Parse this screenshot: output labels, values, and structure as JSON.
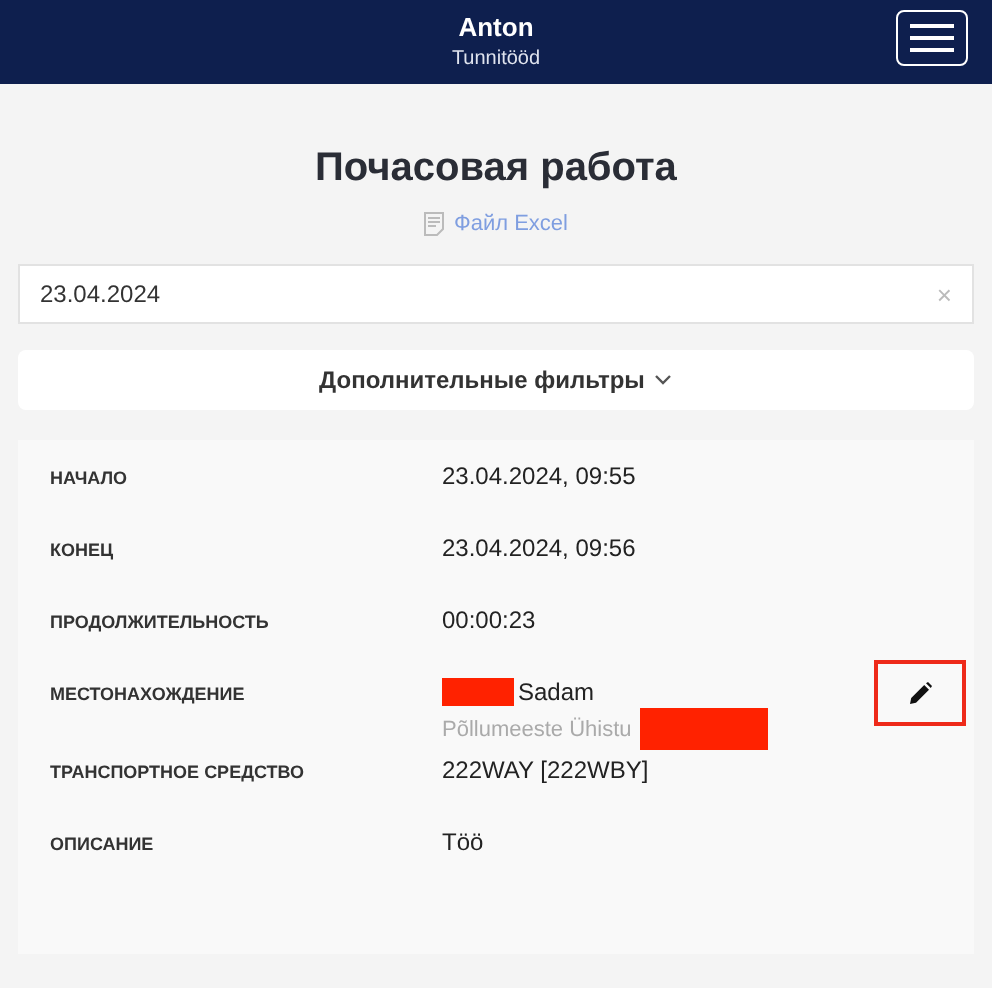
{
  "header": {
    "user": "Anton",
    "subtitle": "Tunnitööd"
  },
  "page": {
    "title": "Почасовая работа",
    "export_link": "Файл Excel"
  },
  "date_filter": {
    "value": "23.04.2024",
    "clear": "×"
  },
  "more_filters": {
    "label": "Дополнительные фильтры",
    "expanded": false
  },
  "details": [
    {
      "label": "НАЧАЛО",
      "lines": [
        {
          "text": "23.04.2024, 09:55",
          "secondary": false
        }
      ]
    },
    {
      "label": "КОНЕЦ",
      "lines": [
        {
          "text": "23.04.2024, 09:56",
          "secondary": false
        }
      ]
    },
    {
      "label": "ПРОДОЛЖИТЕЛЬНОСТЬ",
      "lines": [
        {
          "text": "00:00:23",
          "secondary": false
        }
      ]
    },
    {
      "label": "МЕСТОНАХОЖДЕНИЕ",
      "lines": [
        {
          "text": "Sadam",
          "secondary": false,
          "redacted_before": true
        },
        {
          "text": "Põllumeeste Ühistu",
          "secondary": true,
          "redacted_after": true
        }
      ],
      "editable": true
    },
    {
      "label": "ТРАНСПОРТНОЕ СРЕДСТВО",
      "lines": [
        {
          "text": "222WAY [222WBY]",
          "secondary": false
        }
      ]
    },
    {
      "label": "ОПИСАНИЕ",
      "lines": [
        {
          "text": "Töö",
          "secondary": false
        }
      ]
    }
  ],
  "edit_button": {
    "highlighted": true
  }
}
